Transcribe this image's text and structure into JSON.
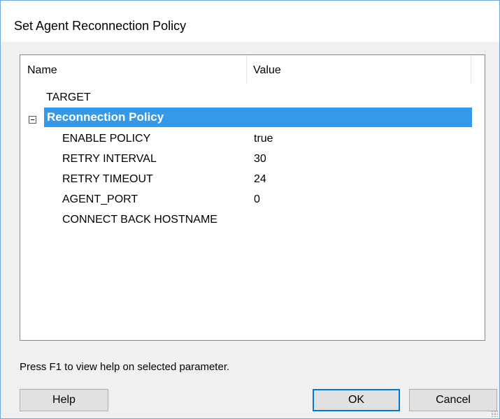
{
  "window": {
    "title": "Set Agent Reconnection Policy"
  },
  "tree": {
    "columns": {
      "name": "Name",
      "value": "Value"
    },
    "rows": [
      {
        "name": "TARGET",
        "value": ""
      },
      {
        "name": "Reconnection Policy",
        "value": "",
        "selected": true,
        "expanded": true
      },
      {
        "name": "ENABLE POLICY",
        "value": "true"
      },
      {
        "name": "RETRY INTERVAL",
        "value": "30"
      },
      {
        "name": "RETRY TIMEOUT",
        "value": "24"
      },
      {
        "name": "AGENT_PORT",
        "value": "0"
      },
      {
        "name": "CONNECT BACK HOSTNAME",
        "value": ""
      }
    ]
  },
  "footer": {
    "hint": "Press F1 to view help on selected parameter.",
    "help_label": "Help",
    "ok_label": "OK",
    "cancel_label": "Cancel"
  },
  "colors": {
    "selection": "#3399e8",
    "ok_focus_border": "#0078d7"
  },
  "icons": {
    "expander": "collapse-minus-icon",
    "resize": "size-grip-icon"
  }
}
